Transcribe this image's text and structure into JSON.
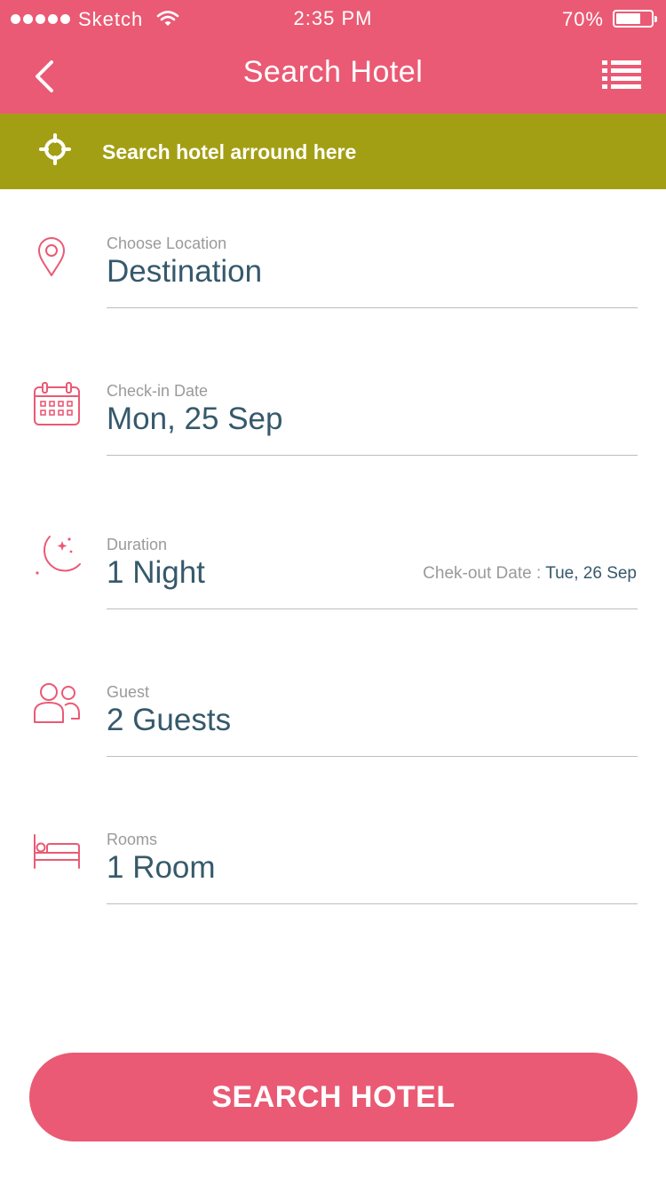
{
  "status_bar": {
    "carrier": "Sketch",
    "time": "2:35 PM",
    "battery": "70%",
    "battery_level": 0.7
  },
  "nav": {
    "title": "Search Hotel",
    "back_icon": "chevron-left-icon",
    "menu_icon": "list-icon"
  },
  "nearby": {
    "label": "Search hotel arround here",
    "icon": "crosshair-icon"
  },
  "fields": {
    "location": {
      "label": "Choose Location",
      "value": "Destination",
      "icon": "map-pin-icon"
    },
    "checkin": {
      "label": "Check-in Date",
      "value": "Mon, 25 Sep",
      "icon": "calendar-icon"
    },
    "duration": {
      "label": "Duration",
      "value": "1 Night",
      "icon": "moon-icon",
      "checkout_label": "Chek-out Date :",
      "checkout_value": "Tue, 26 Sep"
    },
    "guest": {
      "label": "Guest",
      "value": "2 Guests",
      "icon": "users-icon"
    },
    "rooms": {
      "label": "Rooms",
      "value": "1 Room",
      "icon": "bed-icon"
    }
  },
  "search_button": {
    "label": "SEARCH HOTEL"
  },
  "colors": {
    "primary": "#EA5A74",
    "banner": "#A39F14",
    "value_text": "#36596B",
    "label_text": "#9A9A9A",
    "divider": "#BDBDBD"
  }
}
